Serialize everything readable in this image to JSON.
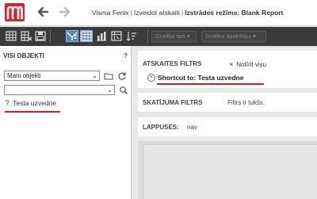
{
  "header": {
    "breadcrumbs": [
      "Visma Fenix",
      "Izveidot atskaiti"
    ],
    "current_page": "Izstrādes režīms: Blank Report",
    "separator": "|"
  },
  "toolbar": {
    "chart_types_label": "Grafika tips",
    "chart_subtypes_label": "Grafika apakštips"
  },
  "left_panel": {
    "title": "VISI OBJEKTI",
    "help": "?",
    "filter_select_value": "Mani objekti",
    "search_value": "",
    "tree_items": [
      {
        "icon": "?",
        "label": "Testa uzvedne"
      }
    ]
  },
  "right_panel": {
    "report_filter": {
      "title": "ATSKAITES FILTRS",
      "clear_all": "Notīrit visu",
      "clear_icon": "×",
      "shortcut_label": "Shortcut to: Testa uzvedne",
      "shortcut_remove": "×"
    },
    "view_filter": {
      "title": "SKATĪJUMA FILTRS",
      "status": "Filtrs ir tukšs."
    },
    "pages": {
      "title": "LAPPUSES:",
      "value": "nav"
    }
  },
  "colors": {
    "brand": "#d8232a",
    "toolbar_bg": "#3b3b3b",
    "highlight_underline": "#e21b23",
    "prompt_icon": "#6aa82c"
  }
}
